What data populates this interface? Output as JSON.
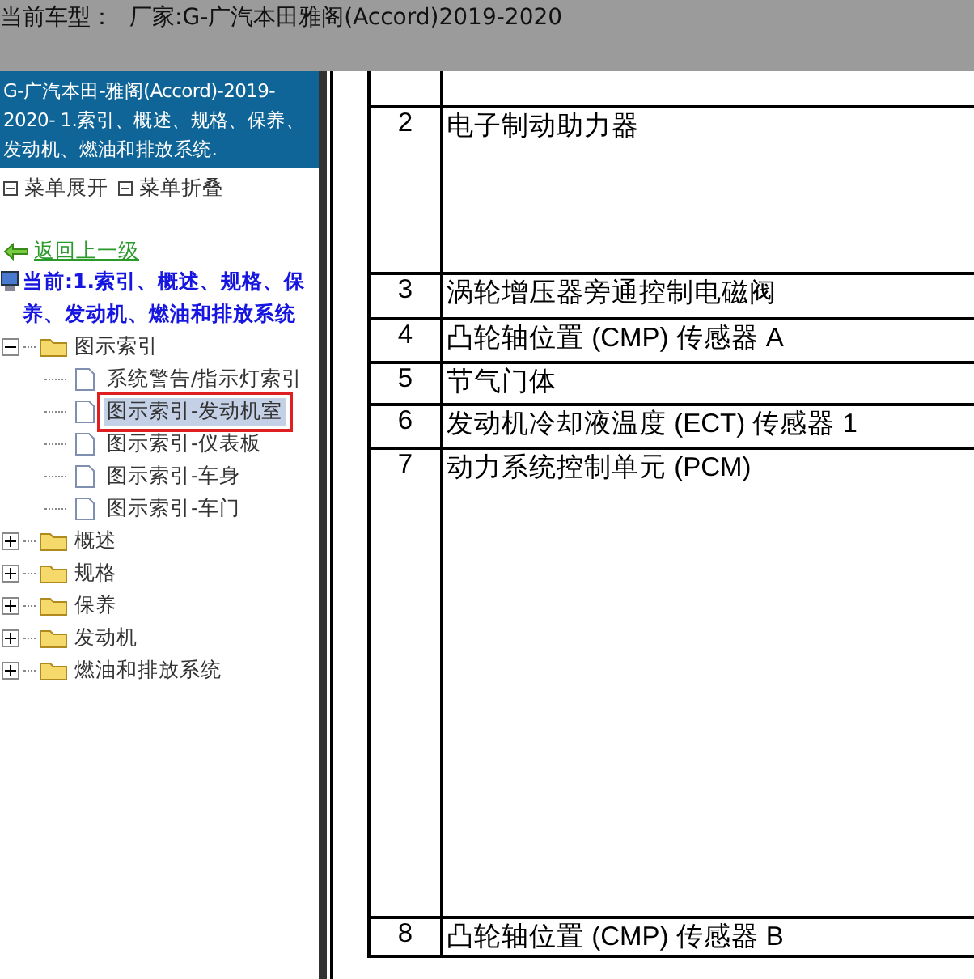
{
  "header": {
    "label": "当前车型：",
    "vehicle": "厂家:G-广汽本田雅阁(Accord)2019-2020"
  },
  "sidebar": {
    "title": "G-广汽本田-雅阁(Accord)-2019-2020- 1.索引、概述、规格、保养、发动机、燃油和排放系统.",
    "menu_actions": [
      {
        "label": "菜单展开"
      },
      {
        "label": "菜单折叠"
      }
    ],
    "back_link": "返回上一级",
    "current": "当前:1.索引、概述、规格、保养、发动机、燃油和排放系统",
    "tree": [
      {
        "label": "图示索引",
        "expanded": true,
        "children": [
          {
            "label": "系统警告/指示灯索引",
            "selected": false,
            "highlighted": false
          },
          {
            "label": "图示索引-发动机室",
            "selected": true,
            "highlighted": true
          },
          {
            "label": "图示索引-仪表板",
            "selected": false,
            "highlighted": false
          },
          {
            "label": "图示索引-车身",
            "selected": false,
            "highlighted": false
          },
          {
            "label": "图示索引-车门",
            "selected": false,
            "highlighted": false
          }
        ]
      },
      {
        "label": "概述",
        "expanded": false
      },
      {
        "label": "规格",
        "expanded": false
      },
      {
        "label": "保养",
        "expanded": false
      },
      {
        "label": "发动机",
        "expanded": false
      },
      {
        "label": "燃油和排放系统",
        "expanded": false
      }
    ]
  },
  "table": {
    "rows": [
      {
        "number": "2",
        "name": "电子制动助力器"
      },
      {
        "number": "3",
        "name": "涡轮增压器旁通控制电磁阀"
      },
      {
        "number": "4",
        "name": "凸轮轴位置 (CMP) 传感器 A"
      },
      {
        "number": "5",
        "name": "节气门体"
      },
      {
        "number": "6",
        "name": "发动机冷却液温度 (ECT) 传感器 1"
      },
      {
        "number": "7",
        "name": "动力系统控制单元 (PCM)"
      },
      {
        "number": "8",
        "name": "凸轮轴位置 (CMP) 传感器 B"
      }
    ]
  }
}
